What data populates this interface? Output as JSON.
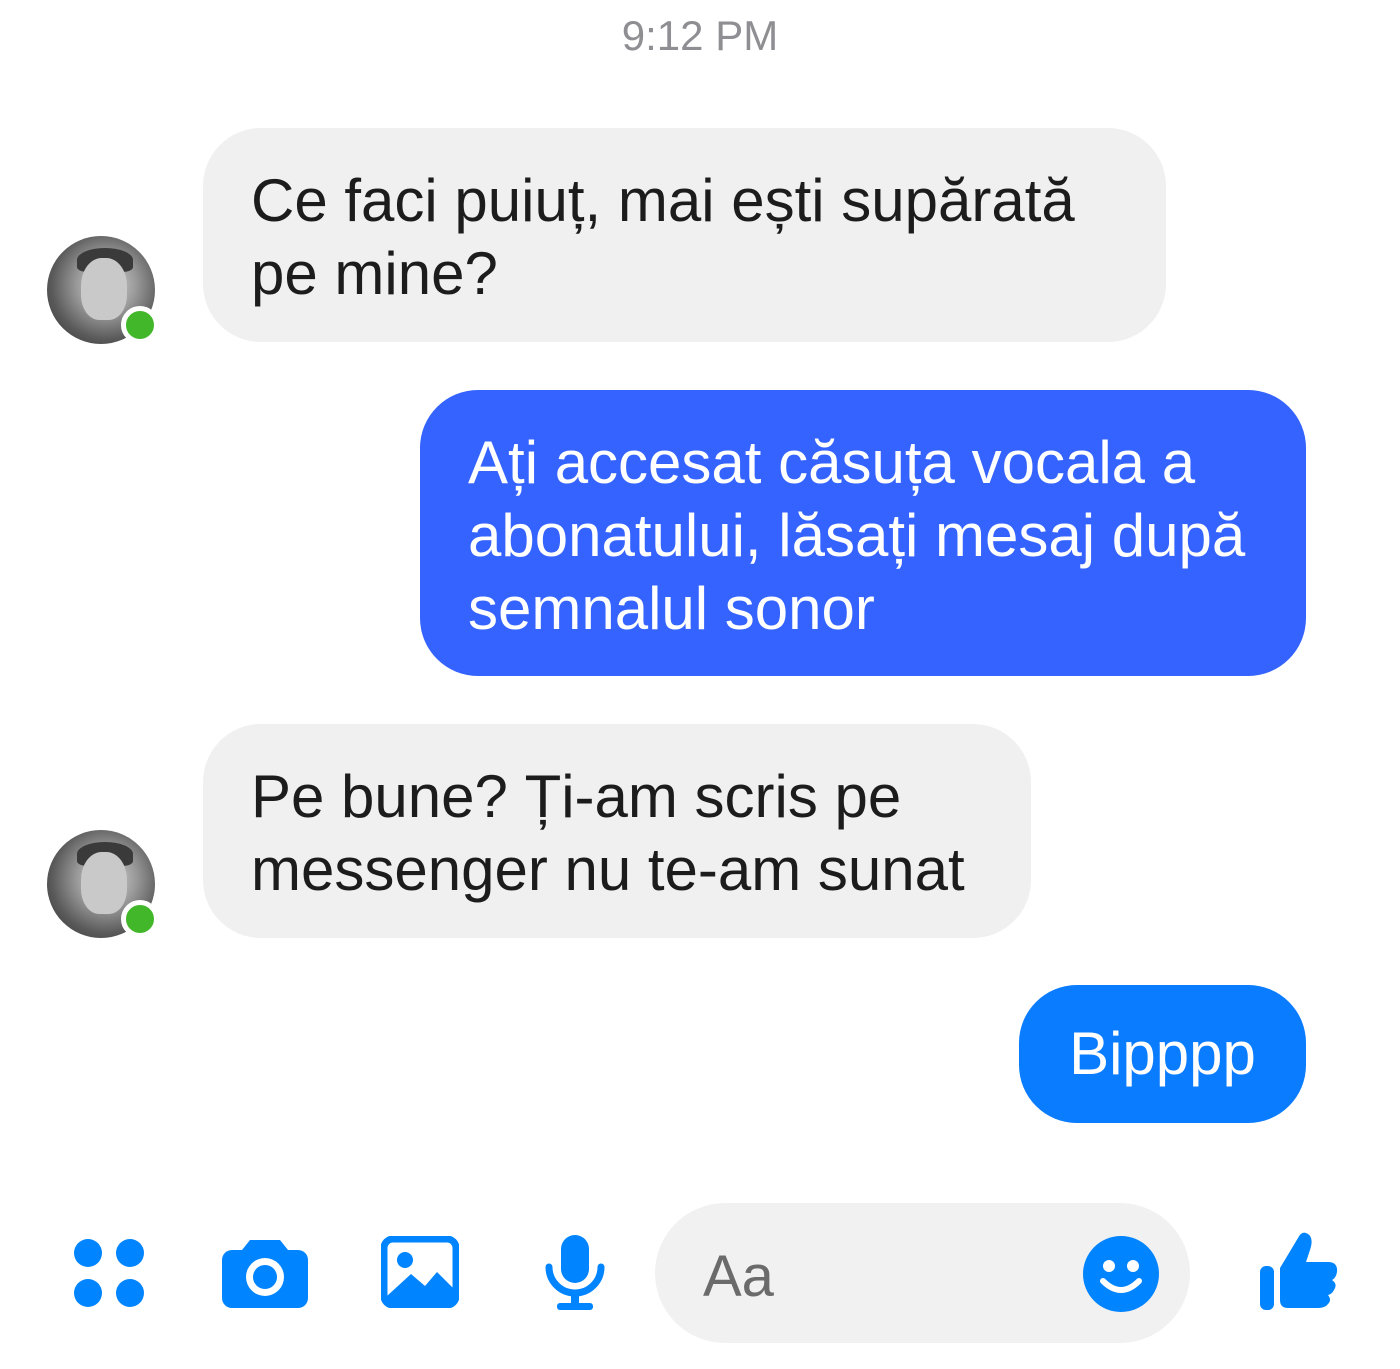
{
  "colors": {
    "accent": "#0084ff",
    "outgoing_first": "#3563ff",
    "outgoing_second": "#0a7cff",
    "incoming_bg": "#f0f0f0",
    "online": "#42b72a"
  },
  "timestamp": "9:12 PM",
  "messages": [
    {
      "from": "them",
      "text": "Ce faci puiuț, mai ești supărată pe mine?"
    },
    {
      "from": "me",
      "text": "Ați accesat căsuța vocala a abonatului, lăsați mesaj după semnalul sonor"
    },
    {
      "from": "them",
      "text": "Pe bune? Ți-am scris pe messenger nu te-am sunat"
    },
    {
      "from": "me",
      "text": "Bipppp"
    }
  ],
  "composer": {
    "placeholder": "Aa",
    "icons": [
      "apps-icon",
      "camera-icon",
      "image-icon",
      "microphone-icon",
      "emoji-icon",
      "thumbs-up-icon"
    ]
  }
}
